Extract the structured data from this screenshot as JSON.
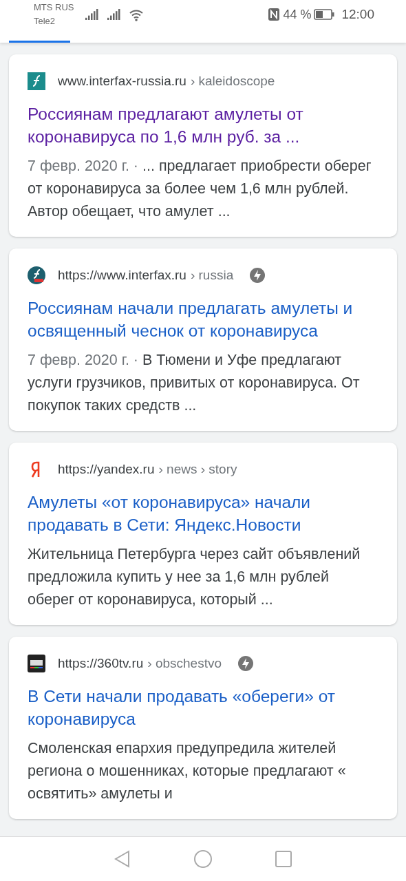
{
  "status_bar": {
    "carriers": [
      "MTS RUS",
      "Tele2"
    ],
    "battery": "44 %",
    "time": "12:00"
  },
  "results": [
    {
      "kind": "interfax",
      "site": "www.interfax-russia.ru",
      "path": "› kaleidoscope",
      "amp": false,
      "visited": true,
      "title": "Россиянам предлагают амулеты от коронавируса по 1,6 млн руб. за ...",
      "date": "7 февр. 2020 г. · ",
      "snippet": "... предлагает приобрести оберег от коронавируса за более чем 1,6 млн рублей. Автор обещает, что амулет ..."
    },
    {
      "kind": "interfaxnews",
      "site": "https://www.interfax.ru",
      "path": "› russia",
      "amp": true,
      "visited": false,
      "title": "Россиянам начали предлагать амулеты и освященный чеснок от коронавируса",
      "date": "7 февр. 2020 г. · ",
      "snippet": "В Тюмени и Уфе предлагают услуги грузчиков, привитых от коронавируса. От покупок таких средств ..."
    },
    {
      "kind": "yandex",
      "site": "https://yandex.ru",
      "path": "› news › story",
      "amp": false,
      "visited": false,
      "title": "Амулеты «от коронавируса» начали продавать в Сети: Яндекс.Новости",
      "snippet": "Жительница Петербурга через сайт объявлений предложила купить у нее за 1,6 млн рублей оберег от коронавируса, который ..."
    },
    {
      "kind": "tv",
      "site": "https://360tv.ru",
      "path": "› obschestvo",
      "amp": true,
      "visited": false,
      "title": "В Сети начали продавать «обереги» от коронавируса",
      "snippet": "Смоленская епархия предупредила жителей региона о мошенниках, которые предлагают « освятить» амулеты и"
    }
  ]
}
